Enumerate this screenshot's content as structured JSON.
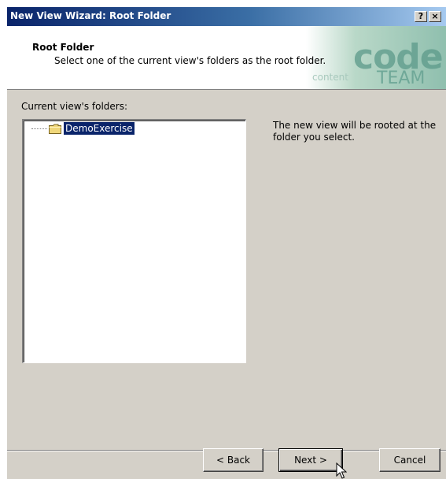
{
  "window": {
    "title": "New View Wizard: Root Folder",
    "help_button": "?",
    "close_button": "×"
  },
  "header": {
    "title": "Root Folder",
    "subtitle": "Select one of the current view's folders as the root folder.",
    "logo_word": "code",
    "logo_sub": "content",
    "logo_team": "TEAM"
  },
  "folders": {
    "label": "Current view's folders:",
    "items": [
      {
        "label": "DemoExercise",
        "selected": true
      }
    ]
  },
  "description": "The new view will be rooted at the folder you select.",
  "buttons": {
    "back": "< Back",
    "next": "Next >",
    "cancel": "Cancel"
  },
  "colors": {
    "selection": "#0a246a",
    "dialog_bg": "#d4d0c8",
    "titlebar_start": "#0a246a",
    "titlebar_end": "#a6caf0"
  }
}
